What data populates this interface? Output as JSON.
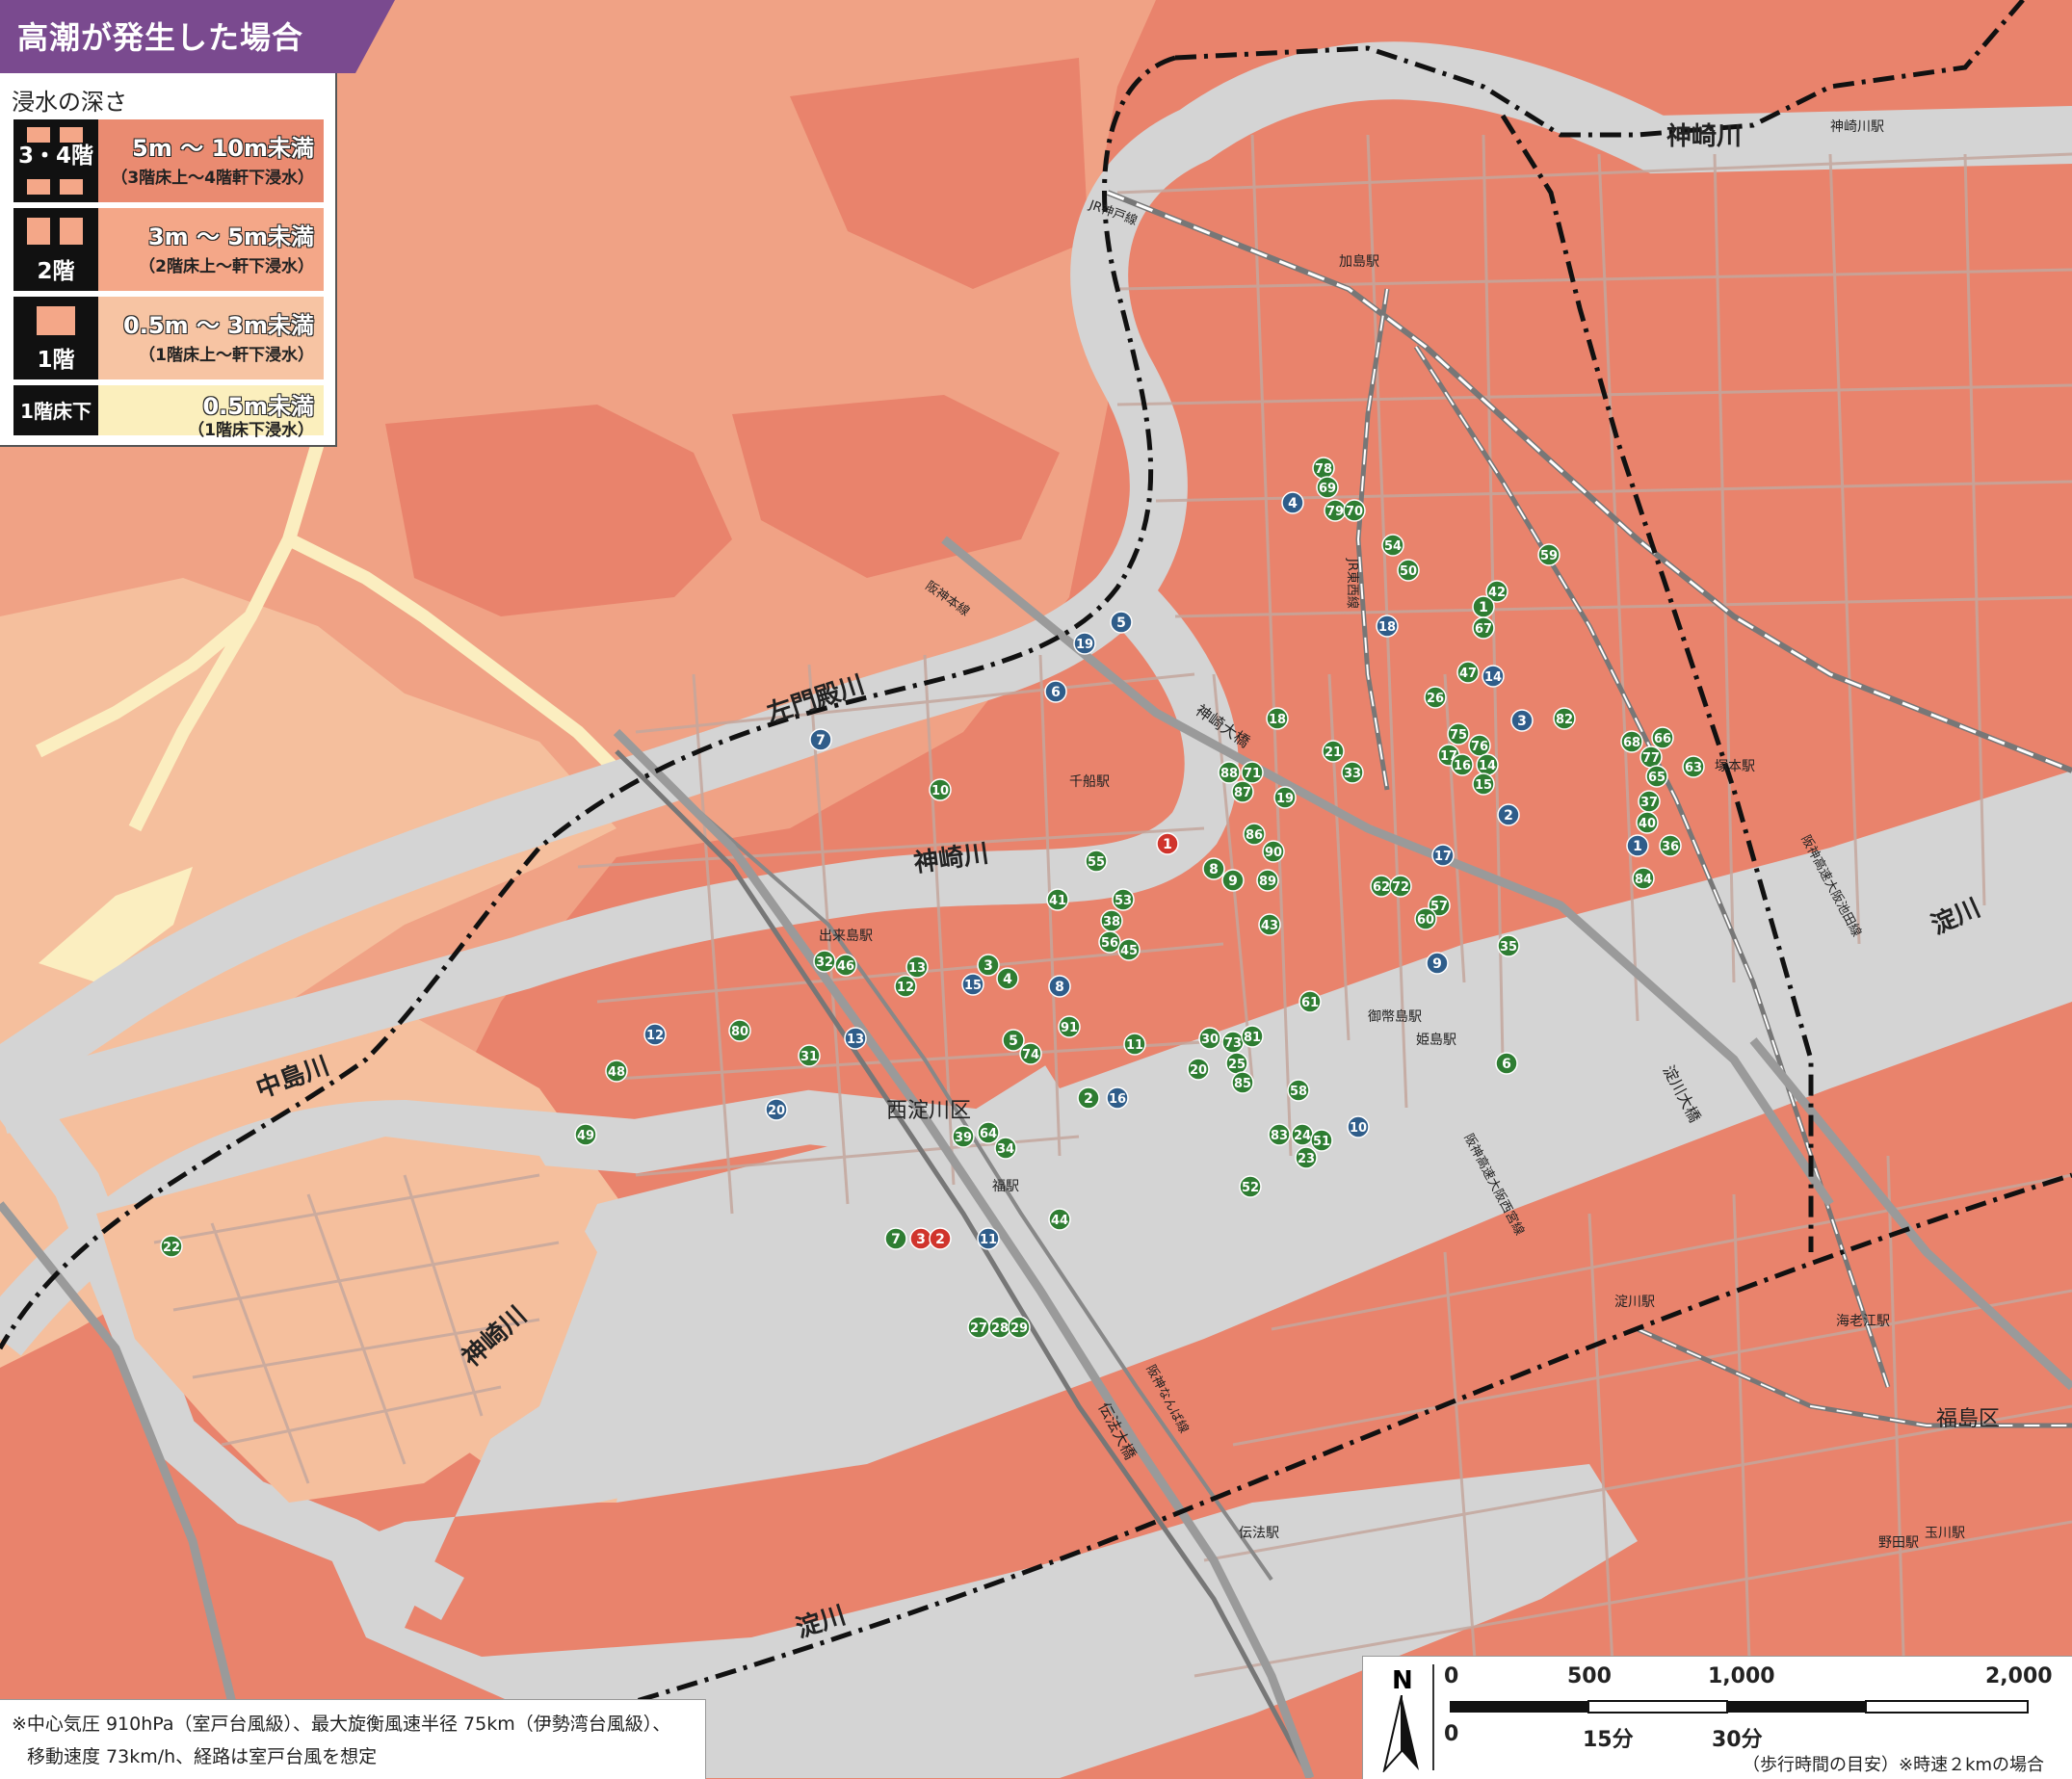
{
  "title": "高潮が発生した場合",
  "legend": {
    "heading": "浸水の深さ",
    "items": [
      {
        "tag": "3・4階",
        "range": "5m ～ 10m未満",
        "note": "（3階床上～4階軒下浸水）",
        "color": "#ea8b71"
      },
      {
        "tag": "2階",
        "range": "3m ～ 5m未満",
        "note": "（2階床上～軒下浸水）",
        "color": "#f4a788"
      },
      {
        "tag": "1階",
        "range": "0.5m ～ 3m未満",
        "note": "（1階床上～軒下浸水）",
        "color": "#f7c4a3"
      },
      {
        "tag": "1階床下",
        "range": "0.5m未満",
        "note": "（1階床下浸水）",
        "color": "#fbefbd"
      }
    ]
  },
  "footnote": {
    "line1": "※中心気圧 910hPa（室戸台風級）、最大旋衡風速半径 75km（伊勢湾台風級）、",
    "line2": "移動速度 73km/h、経路は室戸台風を想定"
  },
  "scale": {
    "north": "N",
    "meters": [
      "0",
      "500",
      "1,000",
      "2,000"
    ],
    "minutes": [
      "0",
      "15分",
      "30分"
    ],
    "caption": "（歩行時間の目安）※時速２kmの場合"
  },
  "map_labels": {
    "rivers": [
      "左門殿川",
      "神崎川",
      "中島川",
      "神崎川",
      "淀川",
      "淀川",
      "神崎川",
      "淀川"
    ],
    "districts": [
      "西淀川区",
      "福島区"
    ],
    "stations": [
      "千船駅",
      "姫島駅",
      "御幣島駅",
      "加島駅",
      "塚本駅",
      "淀川駅",
      "野田駅",
      "海老江駅",
      "伝法駅",
      "福駅",
      "出来島駅",
      "神崎川駅",
      "玉川駅"
    ],
    "bridges": [
      "神崎大橋",
      "伝法大橋",
      "淀川大橋"
    ],
    "railways": [
      "阪神本線",
      "JR東西線",
      "JR神戸線",
      "阪神なんば線",
      "阪神高速大阪池田線",
      "阪神高速大阪西宮線"
    ]
  },
  "colors": {
    "deep": "#e9836c",
    "two_floor": "#f0a285",
    "one_floor": "#f5bf9d",
    "below_floor": "#fbeec0",
    "river": "#d4d4d4",
    "road": "#c4a79d",
    "shelter_green": "#2e7d32",
    "shelter_blue": "#2f5d8a",
    "shelter_red": "#d0342c",
    "title_purple": "#7a4a8f"
  },
  "shelters": [
    {
      "n": "78",
      "c": "green"
    },
    {
      "n": "69",
      "c": "green"
    },
    {
      "n": "79",
      "c": "green"
    },
    {
      "n": "70",
      "c": "green"
    },
    {
      "n": "4",
      "c": "blue"
    },
    {
      "n": "54",
      "c": "green"
    },
    {
      "n": "50",
      "c": "green"
    },
    {
      "n": "59",
      "c": "green"
    },
    {
      "n": "42",
      "c": "green"
    },
    {
      "n": "1",
      "c": "green"
    },
    {
      "n": "67",
      "c": "green"
    },
    {
      "n": "18",
      "c": "blue"
    },
    {
      "n": "5",
      "c": "blue"
    },
    {
      "n": "19",
      "c": "blue"
    },
    {
      "n": "6",
      "c": "blue"
    },
    {
      "n": "47",
      "c": "green"
    },
    {
      "n": "14",
      "c": "blue"
    },
    {
      "n": "26",
      "c": "green"
    },
    {
      "n": "3",
      "c": "blue"
    },
    {
      "n": "82",
      "c": "green"
    },
    {
      "n": "18",
      "c": "green"
    },
    {
      "n": "21",
      "c": "green"
    },
    {
      "n": "33",
      "c": "green"
    },
    {
      "n": "75",
      "c": "green"
    },
    {
      "n": "17",
      "c": "green"
    },
    {
      "n": "76",
      "c": "green"
    },
    {
      "n": "16",
      "c": "green"
    },
    {
      "n": "14",
      "c": "green"
    },
    {
      "n": "15",
      "c": "green"
    },
    {
      "n": "68",
      "c": "green"
    },
    {
      "n": "66",
      "c": "green"
    },
    {
      "n": "77",
      "c": "green"
    },
    {
      "n": "65",
      "c": "green"
    },
    {
      "n": "63",
      "c": "green"
    },
    {
      "n": "7",
      "c": "blue"
    },
    {
      "n": "10",
      "c": "green"
    },
    {
      "n": "88",
      "c": "green"
    },
    {
      "n": "71",
      "c": "green"
    },
    {
      "n": "87",
      "c": "green"
    },
    {
      "n": "19",
      "c": "green"
    },
    {
      "n": "2",
      "c": "blue"
    },
    {
      "n": "37",
      "c": "green"
    },
    {
      "n": "40",
      "c": "green"
    },
    {
      "n": "1",
      "c": "blue"
    },
    {
      "n": "36",
      "c": "green"
    },
    {
      "n": "84",
      "c": "green"
    },
    {
      "n": "1",
      "c": "red"
    },
    {
      "n": "86",
      "c": "green"
    },
    {
      "n": "90",
      "c": "green"
    },
    {
      "n": "8",
      "c": "green"
    },
    {
      "n": "9",
      "c": "green"
    },
    {
      "n": "89",
      "c": "green"
    },
    {
      "n": "17",
      "c": "blue"
    },
    {
      "n": "55",
      "c": "green"
    },
    {
      "n": "62",
      "c": "green"
    },
    {
      "n": "72",
      "c": "green"
    },
    {
      "n": "57",
      "c": "green"
    },
    {
      "n": "60",
      "c": "green"
    },
    {
      "n": "41",
      "c": "green"
    },
    {
      "n": "53",
      "c": "green"
    },
    {
      "n": "38",
      "c": "green"
    },
    {
      "n": "56",
      "c": "green"
    },
    {
      "n": "45",
      "c": "green"
    },
    {
      "n": "43",
      "c": "green"
    },
    {
      "n": "35",
      "c": "green"
    },
    {
      "n": "9",
      "c": "blue"
    },
    {
      "n": "32",
      "c": "green"
    },
    {
      "n": "46",
      "c": "green"
    },
    {
      "n": "13",
      "c": "green"
    },
    {
      "n": "12",
      "c": "green"
    },
    {
      "n": "3",
      "c": "green"
    },
    {
      "n": "4",
      "c": "green"
    },
    {
      "n": "15",
      "c": "blue"
    },
    {
      "n": "8",
      "c": "blue"
    },
    {
      "n": "61",
      "c": "green"
    },
    {
      "n": "80",
      "c": "green"
    },
    {
      "n": "12",
      "c": "blue"
    },
    {
      "n": "13",
      "c": "blue"
    },
    {
      "n": "31",
      "c": "green"
    },
    {
      "n": "5",
      "c": "green"
    },
    {
      "n": "74",
      "c": "green"
    },
    {
      "n": "91",
      "c": "green"
    },
    {
      "n": "11",
      "c": "green"
    },
    {
      "n": "30",
      "c": "green"
    },
    {
      "n": "73",
      "c": "green"
    },
    {
      "n": "81",
      "c": "green"
    },
    {
      "n": "20",
      "c": "green"
    },
    {
      "n": "25",
      "c": "green"
    },
    {
      "n": "85",
      "c": "green"
    },
    {
      "n": "6",
      "c": "green"
    },
    {
      "n": "48",
      "c": "green"
    },
    {
      "n": "2",
      "c": "green"
    },
    {
      "n": "16",
      "c": "blue"
    },
    {
      "n": "58",
      "c": "green"
    },
    {
      "n": "10",
      "c": "blue"
    },
    {
      "n": "20",
      "c": "blue"
    },
    {
      "n": "49",
      "c": "green"
    },
    {
      "n": "39",
      "c": "green"
    },
    {
      "n": "64",
      "c": "green"
    },
    {
      "n": "34",
      "c": "green"
    },
    {
      "n": "83",
      "c": "green"
    },
    {
      "n": "24",
      "c": "green"
    },
    {
      "n": "51",
      "c": "green"
    },
    {
      "n": "23",
      "c": "green"
    },
    {
      "n": "52",
      "c": "green"
    },
    {
      "n": "44",
      "c": "green"
    },
    {
      "n": "22",
      "c": "green"
    },
    {
      "n": "7",
      "c": "green"
    },
    {
      "n": "3",
      "c": "red"
    },
    {
      "n": "2",
      "c": "red"
    },
    {
      "n": "11",
      "c": "blue"
    },
    {
      "n": "27",
      "c": "green"
    },
    {
      "n": "28",
      "c": "green"
    },
    {
      "n": "29",
      "c": "green"
    }
  ]
}
